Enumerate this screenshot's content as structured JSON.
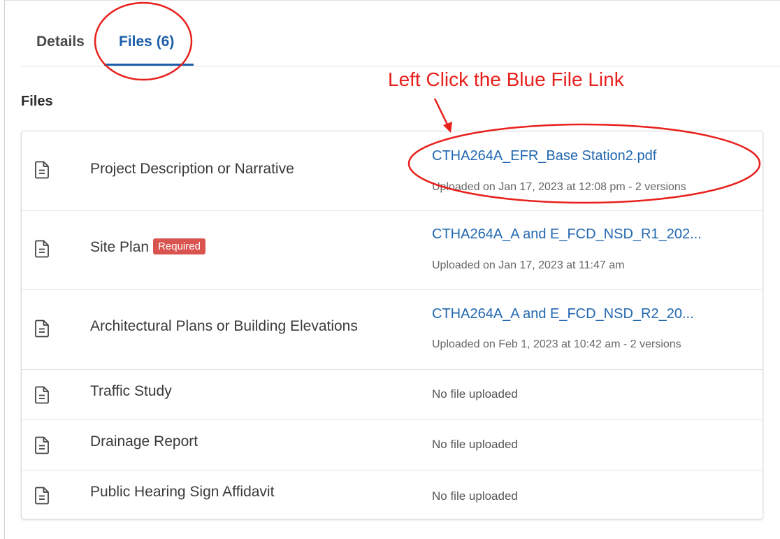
{
  "tabs": {
    "details_label": "Details",
    "files_label": "Files (6)"
  },
  "section_title": "Files",
  "files": [
    {
      "name": "Project Description or Narrative",
      "link": "CTHA264A_EFR_Base Station2.pdf",
      "meta": "Uploaded on Jan 17, 2023 at 12:08 pm - 2 versions"
    },
    {
      "name": "Site Plan",
      "badge": "Required",
      "link": "CTHA264A_A and E_FCD_NSD_R1_202...",
      "meta": "Uploaded on Jan 17, 2023 at 11:47 am"
    },
    {
      "name": "Architectural Plans or Building Elevations",
      "link": "CTHA264A_A and E_FCD_NSD_R2_20...",
      "meta": "Uploaded on Feb 1, 2023 at 10:42 am - 2 versions"
    },
    {
      "name": "Traffic Study",
      "status": "No file uploaded"
    },
    {
      "name": "Drainage Report",
      "status": "No file uploaded"
    },
    {
      "name": "Public Hearing Sign Affidavit",
      "status": "No file uploaded"
    }
  ],
  "annotation": {
    "text": "Left Click the Blue File Link",
    "color": "#e8201c"
  },
  "colors": {
    "link_blue": "#2167b0",
    "tab_active": "#1d5fa8",
    "badge_red": "#d9534f"
  },
  "icons": {
    "file_icon": "file-document-icon"
  }
}
